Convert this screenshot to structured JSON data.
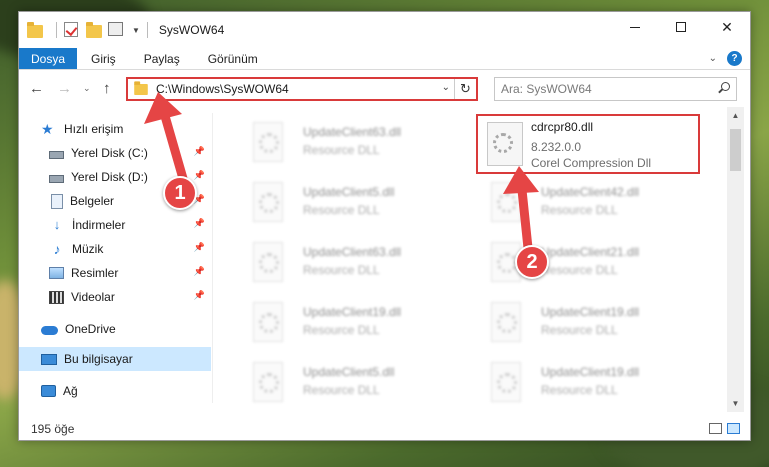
{
  "window": {
    "title": "SysWOW64"
  },
  "ribbon": {
    "tabs": [
      "Dosya",
      "Giriş",
      "Paylaş",
      "Görünüm"
    ],
    "help": "?"
  },
  "address": {
    "path": "C:\\Windows\\SysWOW64",
    "search_placeholder": "Ara: SysWOW64"
  },
  "sidebar": {
    "items": [
      {
        "label": "Hızlı erişim",
        "icon": "star-icon"
      },
      {
        "label": "Yerel Disk (C:)",
        "icon": "drive-icon"
      },
      {
        "label": "Yerel Disk (D:)",
        "icon": "drive-icon"
      },
      {
        "label": "Belgeler",
        "icon": "documents-icon"
      },
      {
        "label": "İndirmeler",
        "icon": "download-icon"
      },
      {
        "label": "Müzik",
        "icon": "music-icon"
      },
      {
        "label": "Resimler",
        "icon": "pictures-icon"
      },
      {
        "label": "Videolar",
        "icon": "videos-icon"
      },
      {
        "label": "OneDrive",
        "icon": "cloud-icon"
      },
      {
        "label": "Bu bilgisayar",
        "icon": "computer-icon"
      },
      {
        "label": "Ağ",
        "icon": "network-icon"
      }
    ]
  },
  "files": [
    {
      "name": "UpdateClient63.dll",
      "type": "Resource DLL"
    },
    {
      "name": "cdrcpr80.dll",
      "version": "8.232.0.0",
      "type": "Corel Compression Dll"
    },
    {
      "name": "UpdateClient5.dll",
      "type": "Resource DLL"
    },
    {
      "name": "UpdateClient42.dll",
      "type": "Resource DLL"
    },
    {
      "name": "UpdateClient63.dll",
      "type": "Resource DLL"
    },
    {
      "name": "UpdateClient21.dll",
      "type": "Resource DLL"
    },
    {
      "name": "UpdateClient19.dll",
      "type": "Resource DLL"
    },
    {
      "name": "UpdateClient19.dll",
      "type": "Resource DLL"
    },
    {
      "name": "UpdateClient5.dll",
      "type": "Resource DLL"
    },
    {
      "name": "UpdateClient19.dll",
      "type": "Resource DLL"
    }
  ],
  "status": {
    "count": "195 öğe"
  },
  "annotations": {
    "step1": "1",
    "step2": "2",
    "color": "#e54545"
  }
}
